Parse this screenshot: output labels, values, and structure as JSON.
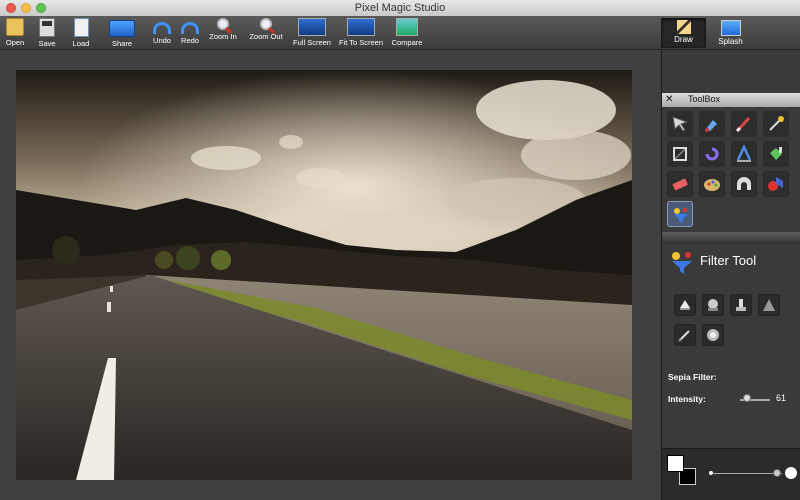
{
  "window": {
    "title": "Pixel Magic Studio"
  },
  "toolbar": {
    "items": [
      {
        "label": "Open",
        "icon": "open-folder-icon"
      },
      {
        "label": "Save",
        "icon": "save-disk-icon"
      },
      {
        "label": "Load",
        "icon": "load-document-icon"
      },
      {
        "label": "Share",
        "icon": "share-icon"
      },
      {
        "label": "Undo",
        "icon": "undo-arrow-icon"
      },
      {
        "label": "Redo",
        "icon": "redo-arrow-icon"
      },
      {
        "label": "Zoom In",
        "icon": "zoom-in-icon"
      },
      {
        "label": "Zoom Out",
        "icon": "zoom-out-icon"
      },
      {
        "label": "Full Screen",
        "icon": "full-screen-icon"
      },
      {
        "label": "Fit To Screen",
        "icon": "fit-to-screen-icon"
      },
      {
        "label": "Compare",
        "icon": "compare-icon"
      }
    ],
    "modes": [
      {
        "label": "Draw",
        "active": true,
        "icon": "draw-pencil-icon"
      },
      {
        "label": "Splash",
        "active": false,
        "icon": "splash-monitor-icon"
      }
    ]
  },
  "toolbox": {
    "title": "ToolBox",
    "tools": [
      "arrow-select-tool-icon",
      "paint-bucket-tool-icon",
      "brush-tool-icon",
      "magic-wand-tool-icon",
      "crop-tool-icon",
      "rotate-tool-icon",
      "text-tool-icon",
      "fill-tool-icon",
      "eraser-tool-icon",
      "palette-tool-icon",
      "stamp-tool-icon",
      "shapes-tool-icon",
      "filter-tool-icon"
    ],
    "selected_tool_index": 12
  },
  "filter_panel": {
    "title": "Filter Tool",
    "sub_tools": [
      "tint-filter-icon",
      "emboss-filter-icon",
      "smudge-filter-icon",
      "sharpen-filter-icon",
      "pencil-filter-icon",
      "blur-filter-icon"
    ],
    "filter_label": "Sepia Filter:",
    "intensity_label": "Intensity:",
    "intensity_value": "61",
    "intensity_fraction": 0.61
  },
  "colors": {
    "foreground": "#ffffff",
    "background": "#000000"
  },
  "brush_size_fraction": 0.9
}
